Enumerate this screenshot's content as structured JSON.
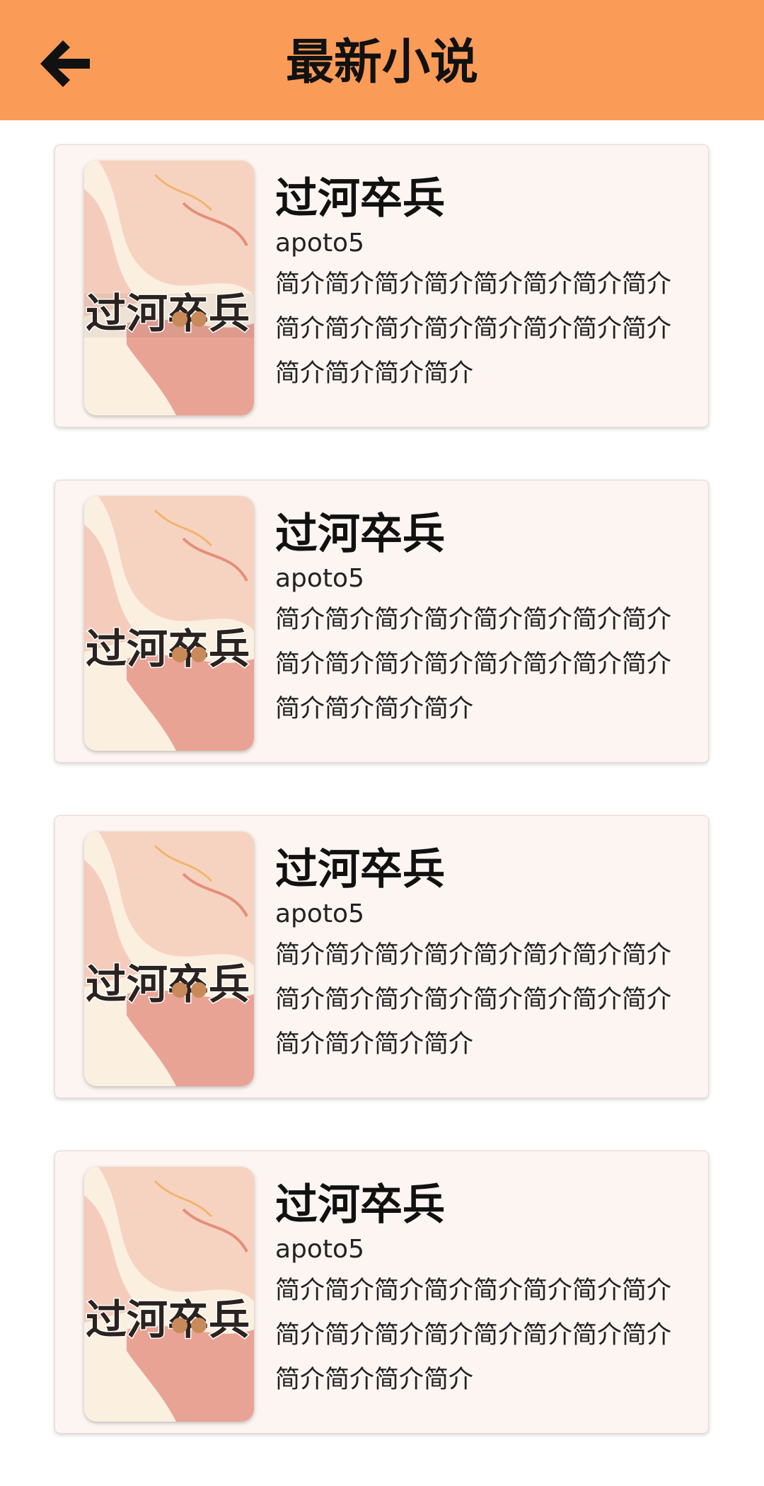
{
  "header": {
    "title": "最新小说",
    "back_icon": "arrow-left-icon",
    "background": "#FB9B58"
  },
  "books": [
    {
      "title": "过河卒兵",
      "author": "apoto5",
      "intro": "简介简介简介简介简介简介简介简介简介简介简介简介简介简介简介简介简介简介简介简介",
      "cover_text": "过河卒兵"
    },
    {
      "title": "过河卒兵",
      "author": "apoto5",
      "intro": "简介简介简介简介简介简介简介简介简介简介简介简介简介简介简介简介简介简介简介简介",
      "cover_text": "过河卒兵"
    },
    {
      "title": "过河卒兵",
      "author": "apoto5",
      "intro": "简介简介简介简介简介简介简介简介简介简介简介简介简介简介简介简介简介简介简介简介",
      "cover_text": "过河卒兵"
    },
    {
      "title": "过河卒兵",
      "author": "apoto5",
      "intro": "简介简介简介简介简介简介简介简介简介简介简介简介简介简介简介简介简介简介简介简介",
      "cover_text": "过河卒兵"
    }
  ]
}
